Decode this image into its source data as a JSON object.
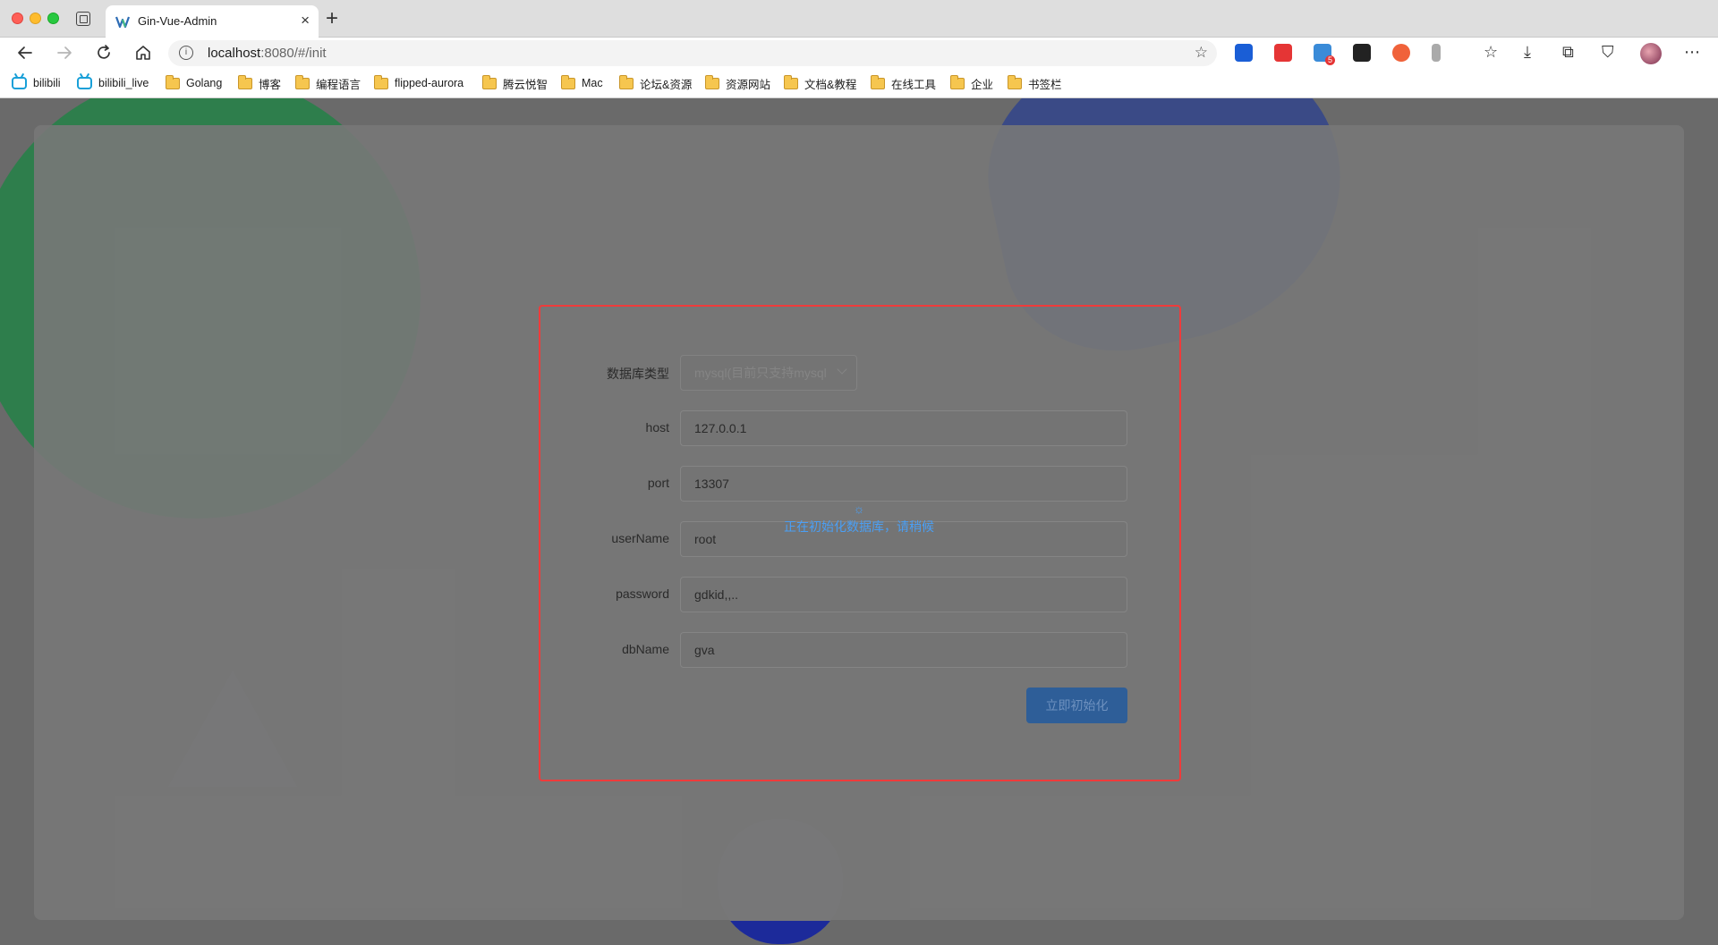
{
  "browser": {
    "tab_title": "Gin-Vue-Admin",
    "new_tab_glyph": "+",
    "close_glyph": "×",
    "url_host": "localhost",
    "url_rest": ":8080/#/init",
    "ext_badge_count": "5"
  },
  "bookmarks": [
    {
      "label": "bilibili",
      "icon": "bilibili-icon"
    },
    {
      "label": "bilibili_live",
      "icon": "bilibili-icon"
    },
    {
      "label": "Golang",
      "icon": "folder-icon"
    },
    {
      "label": "博客",
      "icon": "folder-icon"
    },
    {
      "label": "编程语言",
      "icon": "folder-icon"
    },
    {
      "label": "flipped-aurora",
      "icon": "folder-icon"
    },
    {
      "label": "腾云悦智",
      "icon": "folder-icon"
    },
    {
      "label": "Mac",
      "icon": "folder-icon"
    },
    {
      "label": "论坛&资源",
      "icon": "folder-icon"
    },
    {
      "label": "资源网站",
      "icon": "folder-icon"
    },
    {
      "label": "文档&教程",
      "icon": "folder-icon"
    },
    {
      "label": "在线工具",
      "icon": "folder-icon"
    },
    {
      "label": "企业",
      "icon": "folder-icon"
    },
    {
      "label": "书签栏",
      "icon": "folder-icon"
    }
  ],
  "form": {
    "db_type_label": "数据库类型",
    "db_type_value": "mysql(目前只支持mysql",
    "host_label": "host",
    "host_value": "127.0.0.1",
    "port_label": "port",
    "port_value": "13307",
    "username_label": "userName",
    "username_value": "root",
    "password_label": "password",
    "password_value": "gdkid,,..",
    "dbname_label": "dbName",
    "dbname_value": "gva",
    "submit_label": "立即初始化"
  },
  "loading": {
    "text": "正在初始化数据库，请稍候",
    "spinner_glyph": "☼"
  },
  "colors": {
    "accent": "#409eff",
    "highlight_border": "#ef3b3b",
    "overlay": "#6a6a6a"
  }
}
